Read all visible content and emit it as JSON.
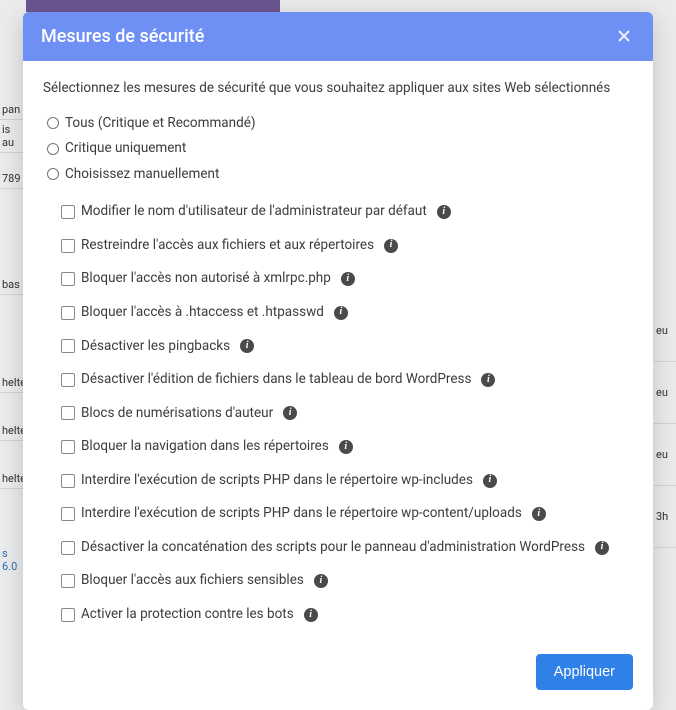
{
  "bg": {
    "frag1": "pan",
    "frag2": "is au",
    "frag3": "789",
    "frag4": "bas",
    "frag5": "helte",
    "frag6": "helte",
    "frag7": "helte",
    "frag8": "s 6.0",
    "right1": "eu",
    "right2": "eu",
    "right3": "eu",
    "right4": "3h"
  },
  "modal": {
    "title": "Mesures de sécurité",
    "intro": "Sélectionnez les mesures de sécurité que vous souhaitez appliquer aux sites Web sélectionnés",
    "radios": [
      {
        "label": "Tous (Critique et Recommandé)"
      },
      {
        "label": "Critique uniquement"
      },
      {
        "label": "Choisissez manuellement"
      }
    ],
    "checkboxes": [
      {
        "label": "Modifier le nom d'utilisateur de l'administrateur par défaut"
      },
      {
        "label": "Restreindre l'accès aux fichiers et aux répertoires"
      },
      {
        "label": "Bloquer l'accès non autorisé à xmlrpc.php"
      },
      {
        "label": "Bloquer l'accès à .htaccess et .htpasswd"
      },
      {
        "label": "Désactiver les pingbacks"
      },
      {
        "label": "Désactiver l'édition de fichiers dans le tableau de bord WordPress"
      },
      {
        "label": "Blocs de numérisations d'auteur"
      },
      {
        "label": "Bloquer la navigation dans les répertoires"
      },
      {
        "label": "Interdire l'exécution de scripts PHP dans le répertoire wp-includes"
      },
      {
        "label": "Interdire l'exécution de scripts PHP dans le répertoire wp-content/uploads"
      },
      {
        "label": "Désactiver la concaténation des scripts pour le panneau d'administration WordPress"
      },
      {
        "label": "Bloquer l'accès aux fichiers sensibles"
      },
      {
        "label": "Activer la protection contre les bots"
      }
    ],
    "apply": "Appliquer"
  }
}
